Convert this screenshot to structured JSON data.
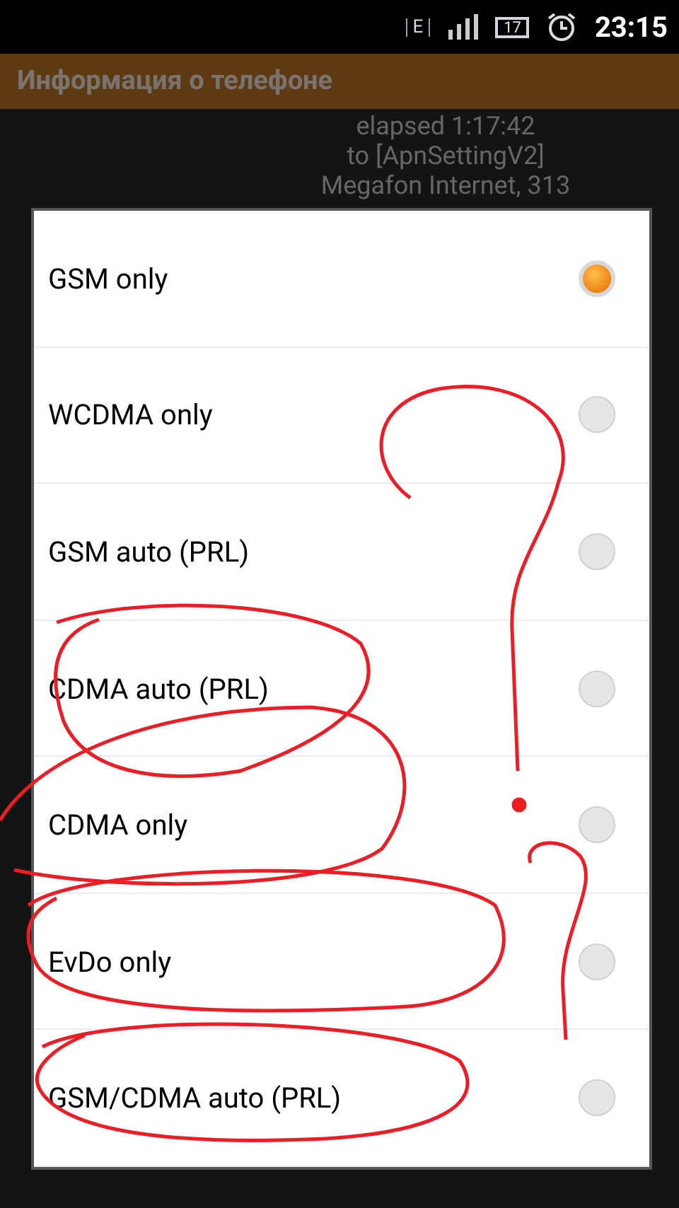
{
  "status_bar": {
    "network": "E",
    "battery": "17",
    "time": "23:15"
  },
  "title_bar": {
    "title": "Информация о телефоне"
  },
  "background_lines": [
    "elapsed 1:17:42",
    "to [ApnSettingV2]",
    "Megafon Internet, 313"
  ],
  "dialog": {
    "options": [
      {
        "label": "GSM only",
        "selected": true
      },
      {
        "label": "WCDMA only",
        "selected": false
      },
      {
        "label": "GSM auto (PRL)",
        "selected": false
      },
      {
        "label": "CDMA auto (PRL)",
        "selected": false
      },
      {
        "label": "CDMA only",
        "selected": false
      },
      {
        "label": "EvDo only",
        "selected": false
      },
      {
        "label": "GSM/CDMA auto (PRL)",
        "selected": false
      }
    ]
  }
}
